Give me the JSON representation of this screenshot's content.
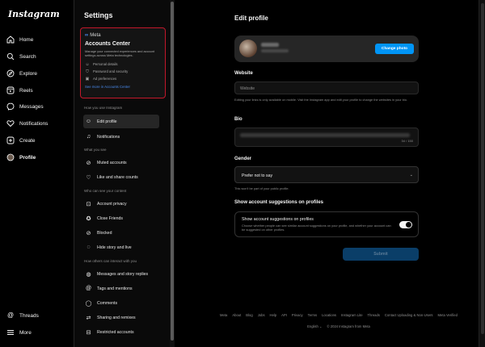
{
  "nav": {
    "logo": "Instagram",
    "items": [
      {
        "label": "Home",
        "icon": "home-icon"
      },
      {
        "label": "Search",
        "icon": "search-icon"
      },
      {
        "label": "Explore",
        "icon": "compass-icon"
      },
      {
        "label": "Reels",
        "icon": "reels-icon"
      },
      {
        "label": "Messages",
        "icon": "messenger-icon"
      },
      {
        "label": "Notifications",
        "icon": "heart-icon"
      },
      {
        "label": "Create",
        "icon": "plus-square-icon"
      },
      {
        "label": "Profile",
        "icon": "avatar-icon"
      }
    ],
    "threads": "Threads",
    "more": "More"
  },
  "settings": {
    "title": "Settings",
    "accounts_center": {
      "brand": "Meta",
      "title": "Accounts Center",
      "description": "Manage your connected experiences and account settings across Meta technologies.",
      "rows": [
        "Personal details",
        "Password and security",
        "Ad preferences"
      ],
      "link": "See more in Accounts Center"
    },
    "sections": [
      {
        "label": "How you use Instagram",
        "items": [
          "Edit profile",
          "Notifications"
        ]
      },
      {
        "label": "What you see",
        "items": [
          "Muted accounts",
          "Like and share counts"
        ]
      },
      {
        "label": "Who can see your content",
        "items": [
          "Account privacy",
          "Close Friends",
          "Blocked",
          "Hide story and live"
        ]
      },
      {
        "label": "How others can interact with you",
        "items": [
          "Messages and story replies",
          "Tags and mentions",
          "Comments",
          "Sharing and remixes",
          "Restricted accounts"
        ]
      }
    ]
  },
  "main": {
    "title": "Edit profile",
    "change_photo": "Change photo",
    "website_label": "Website",
    "website_placeholder": "Website",
    "website_hint": "Editing your links is only available on mobile. Visit the Instagram app and edit your profile to change the websites in your bio.",
    "bio_label": "Bio",
    "bio_count": "34 / 150",
    "gender_label": "Gender",
    "gender_value": "Prefer not to say",
    "gender_hint": "This won't be part of your public profile.",
    "suggestions_heading": "Show account suggestions on profiles",
    "suggestions_title": "Show account suggestions on profiles",
    "suggestions_desc": "Choose whether people can see similar account suggestions on your profile, and whether your account can be suggested on other profiles.",
    "suggestions_on": true,
    "submit": "Submit"
  },
  "footer": {
    "links": [
      "Meta",
      "About",
      "Blog",
      "Jobs",
      "Help",
      "API",
      "Privacy",
      "Terms",
      "Locations",
      "Instagram Lite",
      "Threads",
      "Contact Uploading & Non-Users",
      "Meta Verified"
    ],
    "language": "English",
    "copyright": "© 2024 Instagram from Meta"
  },
  "colors": {
    "accent": "#0095f6",
    "highlight_border": "#c2182b",
    "background": "#000000"
  }
}
